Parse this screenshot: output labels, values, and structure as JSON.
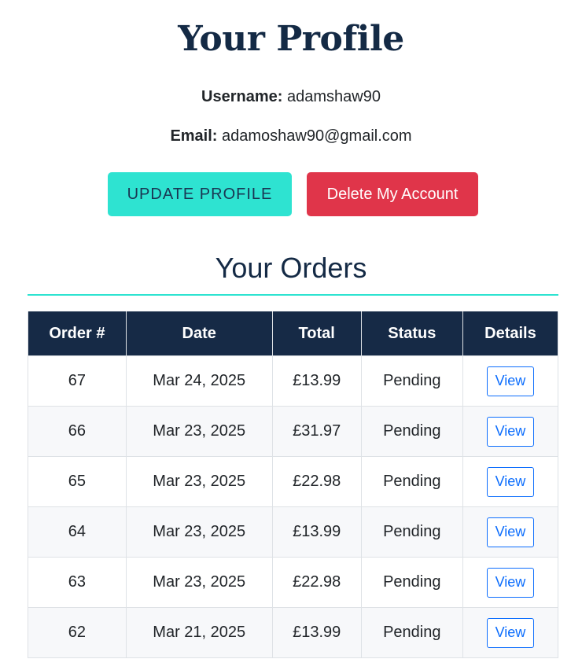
{
  "page": {
    "title": "Your Profile"
  },
  "profile": {
    "username_label": "Username:",
    "username": "adamshaw90",
    "email_label": "Email:",
    "email": "adamoshaw90@gmail.com"
  },
  "actions": {
    "update_label": "Update Profile",
    "delete_label": "Delete My Account"
  },
  "orders": {
    "title": "Your Orders",
    "columns": [
      "Order #",
      "Date",
      "Total",
      "Status",
      "Details"
    ],
    "rows": [
      {
        "order": "67",
        "date": "Mar 24, 2025",
        "total": "£13.99",
        "status": "Pending",
        "details": "View"
      },
      {
        "order": "66",
        "date": "Mar 23, 2025",
        "total": "£31.97",
        "status": "Pending",
        "details": "View"
      },
      {
        "order": "65",
        "date": "Mar 23, 2025",
        "total": "£22.98",
        "status": "Pending",
        "details": "View"
      },
      {
        "order": "64",
        "date": "Mar 23, 2025",
        "total": "£13.99",
        "status": "Pending",
        "details": "View"
      },
      {
        "order": "63",
        "date": "Mar 23, 2025",
        "total": "£22.98",
        "status": "Pending",
        "details": "View"
      },
      {
        "order": "62",
        "date": "Mar 21, 2025",
        "total": "£13.99",
        "status": "Pending",
        "details": "View"
      }
    ]
  },
  "colors": {
    "heading": "#142a45",
    "accent": "#2ee3d1",
    "danger": "#e0354a",
    "table_header": "#162a46",
    "link": "#0d6efd"
  }
}
